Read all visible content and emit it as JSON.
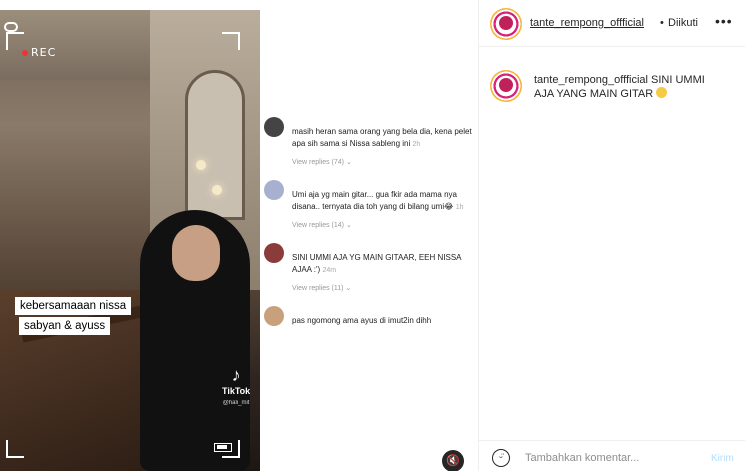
{
  "header": {
    "username": "tante_rempong_offficial",
    "separator": "•",
    "follow_status": "Diikuti",
    "more": "•••"
  },
  "post": {
    "username": "tante_rempong_offficial",
    "caption": "SINI UMMI AJA YANG MAIN GITAR",
    "caption_emoji": "grinning-face"
  },
  "video": {
    "rec_label": "REC",
    "caption_lines": [
      "kebersamaaan nissa",
      "sabyan & ayuss"
    ],
    "tiktok_label": "TikTok",
    "tiktok_user": "@hali_mit"
  },
  "comments": [
    {
      "name": "",
      "text": "masih heran sama orang yang bela dia, kena pelet apa sih sama si Nissa sableng ini",
      "time": "2h",
      "replies": "View replies (74)"
    },
    {
      "name": "",
      "text": "Umi aja yg main gitar... gua fkir ada mama nya disana.. ternyata dia toh yang di bilang umi😂",
      "time": "1h",
      "replies": "View replies (14)"
    },
    {
      "name": "",
      "text": "SINI UMMI AJA YG MAIN GITAAR, EEH NISSA AJAA :')",
      "time": "24m",
      "replies": "View replies (11)"
    },
    {
      "name": "",
      "text": "pas ngomong ama ayus di imut2in dihh",
      "time": "",
      "replies": ""
    }
  ],
  "footer": {
    "comment_placeholder": "Tambahkan komentar...",
    "send_label": "Kirim"
  },
  "colors": {
    "link_muted": "#b2dffc",
    "text": "#262626",
    "border": "#efefef"
  }
}
